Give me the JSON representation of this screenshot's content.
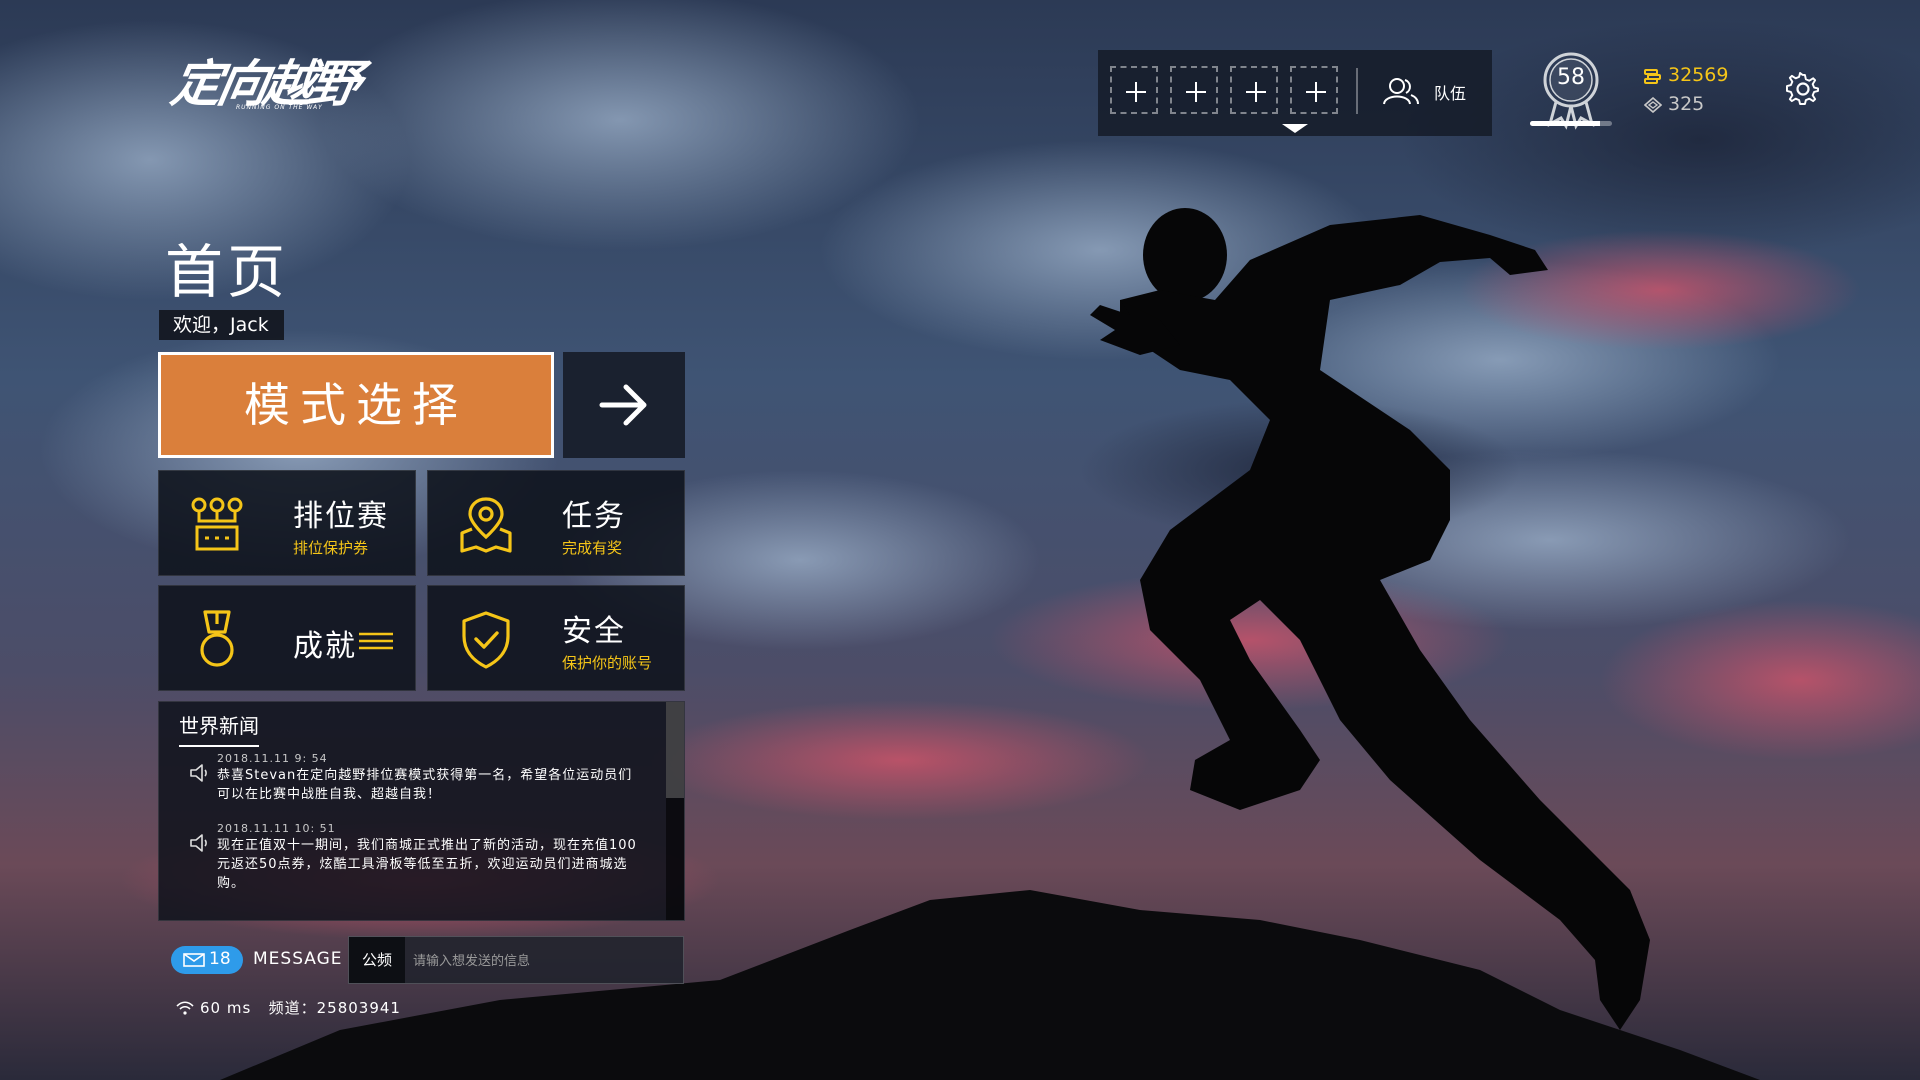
{
  "logo": {
    "title": "定向越野",
    "subtitle": "RUNNING ON THE WAY"
  },
  "topbar": {
    "team_label": "队伍",
    "level": "58",
    "level_progress": 0.85,
    "coins": "32569",
    "gems": "325"
  },
  "page": {
    "title": "首页",
    "welcome": "欢迎，Jack"
  },
  "mode_button": {
    "label": "模式选择"
  },
  "tiles": [
    {
      "name": "排位赛",
      "sub": "排位保护券"
    },
    {
      "name": "任务",
      "sub": "完成有奖"
    },
    {
      "name": "成就",
      "sub": ""
    },
    {
      "name": "安全",
      "sub": "保护你的账号"
    }
  ],
  "news": {
    "title": "世界新闻",
    "items": [
      {
        "time": "2018.11.11 9: 54",
        "text": "恭喜Stevan在定向越野排位赛模式获得第一名，希望各位运动员们可以在比赛中战胜自我、超越自我！"
      },
      {
        "time": "2018.11.11 10: 51",
        "text": "现在正值双十一期间，我们商城正式推出了新的活动，现在充值100元返还50点券，炫酷工具滑板等低至五折，欢迎运动员们进商城选购。"
      }
    ]
  },
  "message": {
    "count": "18",
    "label": "MESSAGE",
    "channel": "公频",
    "placeholder": "请输入想发送的信息"
  },
  "status": {
    "ping": "60 ms",
    "channel": "频道：25803941"
  },
  "colors": {
    "accent": "#da7f3b",
    "gold": "#f5c518",
    "badge": "#2e9bea"
  }
}
